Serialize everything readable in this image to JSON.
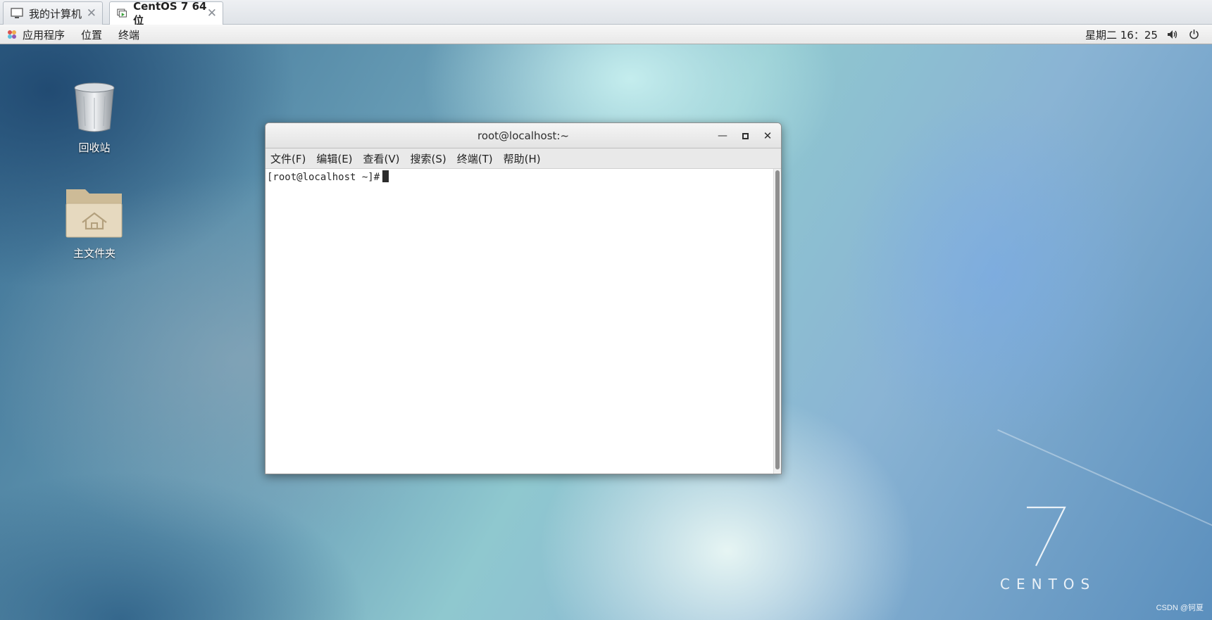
{
  "vm_tabs": [
    {
      "label": "我的计算机",
      "icon": "monitor-icon"
    },
    {
      "label": "CentOS 7 64 位",
      "icon": "vm-running-icon"
    }
  ],
  "panel": {
    "menus": [
      "应用程序",
      "位置",
      "终端"
    ],
    "clock": "星期二 16：25",
    "icons": [
      "apps-icon",
      "volume-icon",
      "power-icon"
    ]
  },
  "desktop": {
    "icons": [
      {
        "label": "回收站",
        "icon": "trash-icon"
      },
      {
        "label": "主文件夹",
        "icon": "home-folder-icon"
      }
    ],
    "logo": {
      "number": "7",
      "word": "CENTOS"
    },
    "watermark": "CSDN @钶夏"
  },
  "terminal": {
    "title": "root@localhost:~",
    "menu": [
      "文件(F)",
      "编辑(E)",
      "查看(V)",
      "搜索(S)",
      "终端(T)",
      "帮助(H)"
    ],
    "prompt": "[root@localhost ~]#"
  }
}
